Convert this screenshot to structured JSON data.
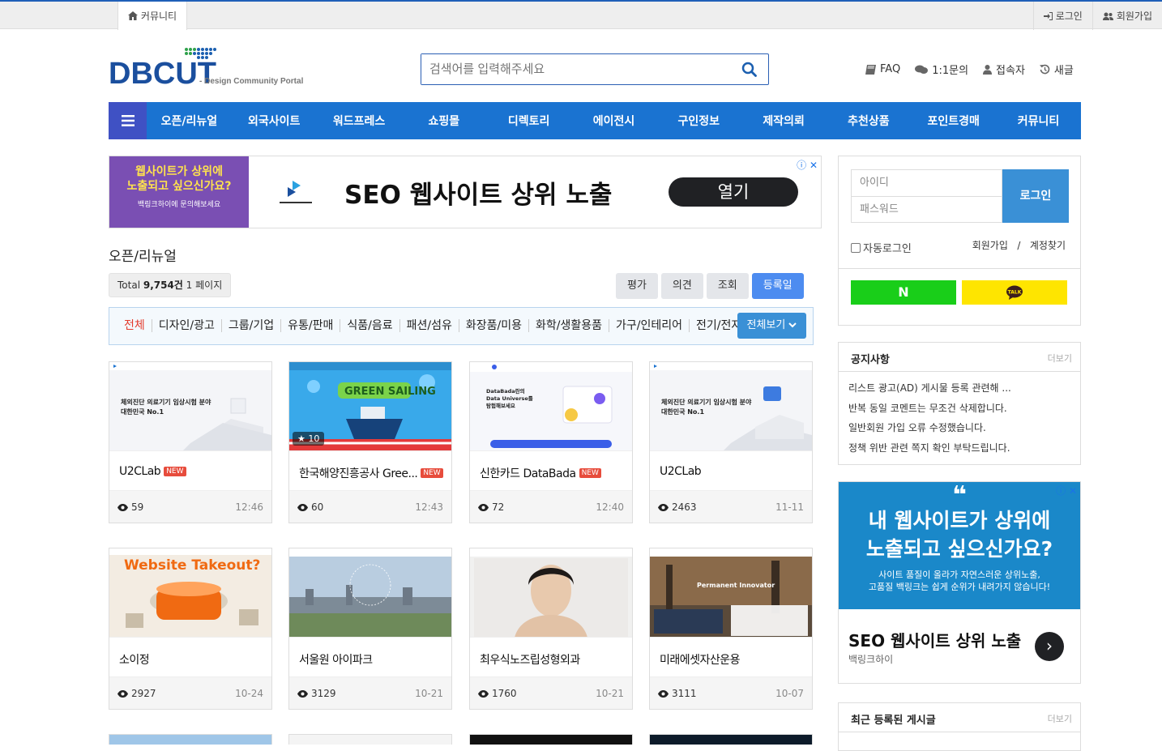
{
  "topbar": {
    "tab_label": "커뮤니티",
    "login": "로그인",
    "signup": "회원가입"
  },
  "logo": {
    "main": "DBCUT",
    "sub": "- Design Community Portal"
  },
  "search": {
    "placeholder": "검색어를 입력해주세요"
  },
  "utility": {
    "faq": "FAQ",
    "inquiry": "1:1문의",
    "visitors": "접속자",
    "refresh": "새글"
  },
  "nav": {
    "items": [
      "오픈/리뉴얼",
      "외국사이트",
      "워드프레스",
      "쇼핑몰",
      "디렉토리",
      "에이전시",
      "구인정보",
      "제작의뢰",
      "추천상품",
      "포인트경매",
      "커뮤니티"
    ]
  },
  "ad_top": {
    "left_line1": "웹사이트가 상위에",
    "left_line2": "노출되고 싶으신가요?",
    "left_line3": "백링크하이에 문의해보세요",
    "headline": "SEO 웹사이트 상위 노출",
    "button": "열기",
    "close": "ⓘ ✕"
  },
  "board": {
    "title": "오픈/리뉴얼",
    "total_prefix": "Total ",
    "total_count": "9,754건",
    "total_suffix": " 1 페이지"
  },
  "sorts": [
    "평가",
    "의견",
    "조회",
    "등록일"
  ],
  "categories": [
    "전체",
    "디자인/광고",
    "그룹/기업",
    "유통/판매",
    "식품/음료",
    "패션/섬유",
    "화장품/미용",
    "화학/생활용품",
    "가구/인테리어",
    "전기/전자"
  ],
  "view_all": "전체보기",
  "cards": [
    {
      "title": "U2CLab",
      "new": "NEW",
      "views": "59",
      "date": "12:46"
    },
    {
      "title": "한국해양진흥공사 Gree...",
      "new": "NEW",
      "views": "60",
      "date": "12:43",
      "badge": "10"
    },
    {
      "title": "신한카드 DataBada",
      "new": "NEW",
      "views": "72",
      "date": "12:40"
    },
    {
      "title": "U2CLab",
      "new": "",
      "views": "2463",
      "date": "11-11"
    },
    {
      "title": "소이정",
      "new": "",
      "views": "2927",
      "date": "10-24"
    },
    {
      "title": "서울원 아이파크",
      "new": "",
      "views": "3129",
      "date": "10-21"
    },
    {
      "title": "최우식노즈립성형외과",
      "new": "",
      "views": "1760",
      "date": "10-21"
    },
    {
      "title": "미래에셋자산운용",
      "new": "",
      "views": "3111",
      "date": "10-07"
    }
  ],
  "thumbs": {
    "lab_text": "체외진단 의료기기 임상시험 분야 대한민국 No.1",
    "green": "GREEN SAILING",
    "databada": "DataBada란의 Data Universe를 탐험해보세요",
    "takeout": "Website Takeout?",
    "innovator": "Permanent Innovator"
  },
  "login_box": {
    "id_placeholder": "아이디",
    "pw_placeholder": "패스워드",
    "button": "로그인",
    "auto": "자동로그인",
    "join": "회원가입",
    "find": "계정찾기",
    "sep": "/",
    "naver": "N",
    "kakao": "TALK"
  },
  "notice": {
    "title": "공지사항",
    "more": "더보기",
    "items": [
      "리스트 광고(AD) 게시물 등록 관련해 ...",
      "반복 동일 코멘트는 무조건 삭제합니다.",
      "일반회원 가입 오류 수정했습니다.",
      "정책 위반 관련 쪽지 확인 부탁드립니다."
    ]
  },
  "ad_side": {
    "quote": "❝",
    "line1": "내 웹사이트가 상위에",
    "line2": "노출되고 싶으신가요?",
    "sub1": "사이트 품질이 올라가 자연스러운 상위노출,",
    "sub2": "고품질 백링크는 쉽게 순위가 내려가지 않습니다!",
    "headline": "SEO 웹사이트 상위 노출",
    "brand": "백링크하이",
    "close": "ⓘ ✕"
  },
  "recent": {
    "title": "최근 등록된 게시글",
    "more": "더보기"
  }
}
